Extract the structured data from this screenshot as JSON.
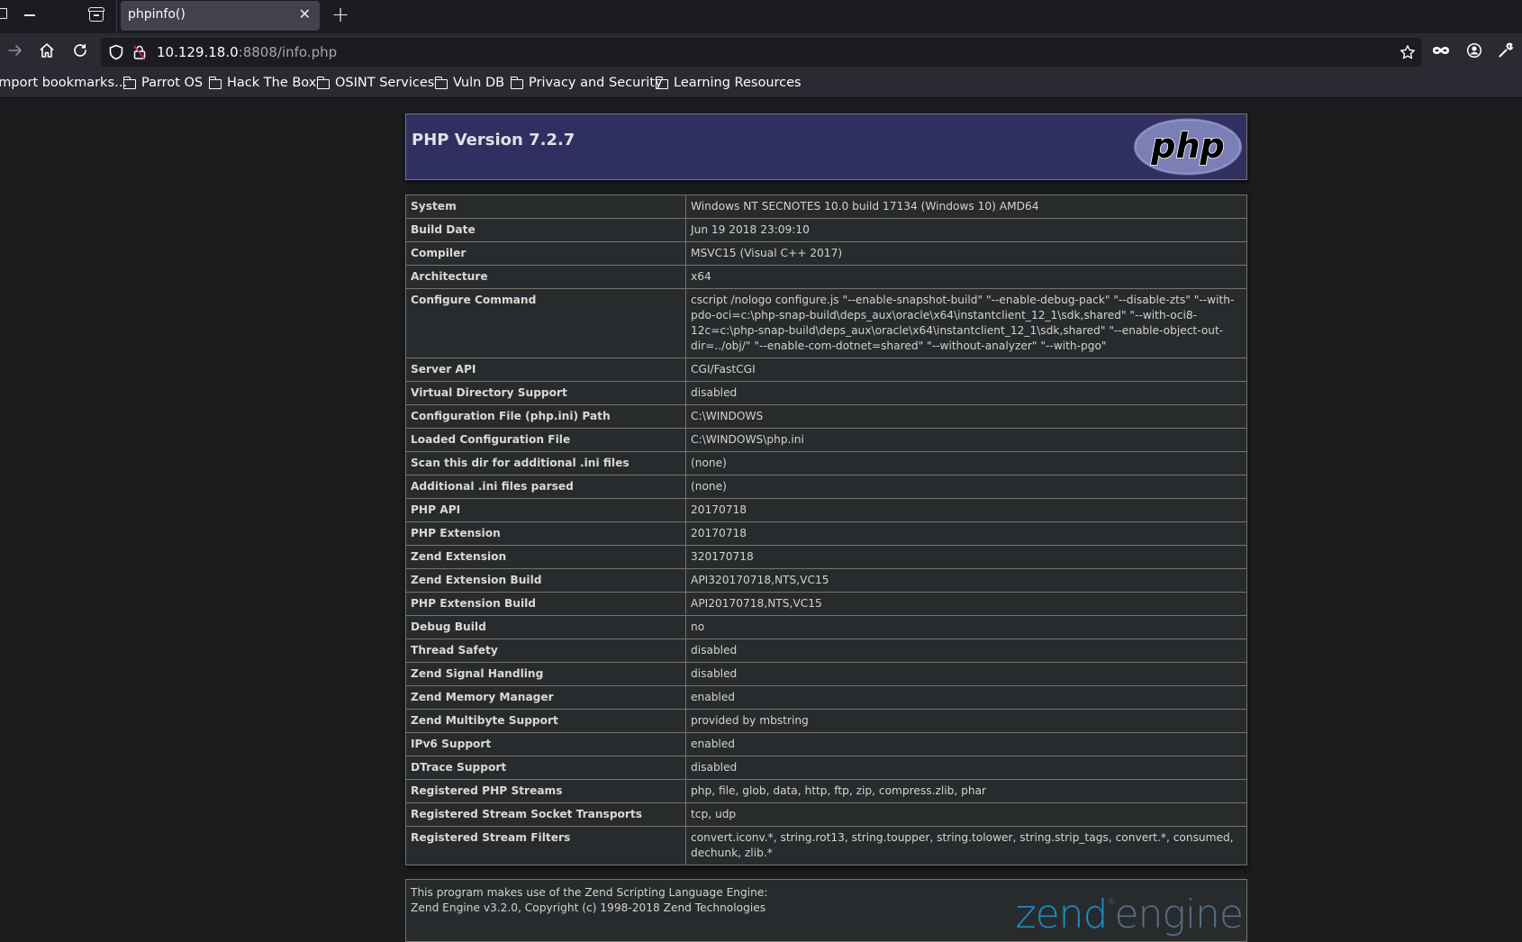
{
  "browser": {
    "tab": {
      "title": "phpinfo()"
    },
    "url": {
      "host": "10.129.18.0",
      "rest": ":8808/info.php"
    },
    "bookmarks": [
      {
        "label": "Import bookmarks…",
        "folder": false
      },
      {
        "label": "Parrot OS",
        "folder": true
      },
      {
        "label": "Hack The Box",
        "folder": true
      },
      {
        "label": "OSINT Services",
        "folder": true
      },
      {
        "label": "Vuln DB",
        "folder": true
      },
      {
        "label": "Privacy and Security",
        "folder": true
      },
      {
        "label": "Learning Resources",
        "folder": true
      }
    ],
    "icons": {
      "back": "arrow-right-icon",
      "home": "home-icon",
      "reload": "reload-icon",
      "tracking": "shield-icon",
      "insecure": "lock-insecure-icon",
      "bookmark": "star-icon",
      "private": "mask-icon",
      "account": "account-icon",
      "tools": "wrench-icon"
    }
  },
  "phpinfo": {
    "title": "PHP Version 7.2.7",
    "logo_text": "php",
    "rows": [
      {
        "key": "System",
        "value": "Windows NT SECNOTES 10.0 build 17134 (Windows 10) AMD64"
      },
      {
        "key": "Build Date",
        "value": "Jun 19 2018 23:09:10"
      },
      {
        "key": "Compiler",
        "value": "MSVC15 (Visual C++ 2017)"
      },
      {
        "key": "Architecture",
        "value": "x64"
      },
      {
        "key": "Configure Command",
        "value": "cscript /nologo configure.js \"--enable-snapshot-build\" \"--enable-debug-pack\" \"--disable-zts\" \"--with-pdo-oci=c:\\php-snap-build\\deps_aux\\oracle\\x64\\instantclient_12_1\\sdk,shared\" \"--with-oci8-12c=c:\\php-snap-build\\deps_aux\\oracle\\x64\\instantclient_12_1\\sdk,shared\" \"--enable-object-out-dir=../obj/\" \"--enable-com-dotnet=shared\" \"--without-analyzer\" \"--with-pgo\""
      },
      {
        "key": "Server API",
        "value": "CGI/FastCGI"
      },
      {
        "key": "Virtual Directory Support",
        "value": "disabled"
      },
      {
        "key": "Configuration File (php.ini) Path",
        "value": "C:\\WINDOWS"
      },
      {
        "key": "Loaded Configuration File",
        "value": "C:\\WINDOWS\\php.ini"
      },
      {
        "key": "Scan this dir for additional .ini files",
        "value": "(none)"
      },
      {
        "key": "Additional .ini files parsed",
        "value": "(none)"
      },
      {
        "key": "PHP API",
        "value": "20170718"
      },
      {
        "key": "PHP Extension",
        "value": "20170718"
      },
      {
        "key": "Zend Extension",
        "value": "320170718"
      },
      {
        "key": "Zend Extension Build",
        "value": "API320170718,NTS,VC15"
      },
      {
        "key": "PHP Extension Build",
        "value": "API20170718,NTS,VC15"
      },
      {
        "key": "Debug Build",
        "value": "no"
      },
      {
        "key": "Thread Safety",
        "value": "disabled"
      },
      {
        "key": "Zend Signal Handling",
        "value": "disabled"
      },
      {
        "key": "Zend Memory Manager",
        "value": "enabled"
      },
      {
        "key": "Zend Multibyte Support",
        "value": "provided by mbstring"
      },
      {
        "key": "IPv6 Support",
        "value": "enabled"
      },
      {
        "key": "DTrace Support",
        "value": "disabled"
      },
      {
        "key": "Registered PHP Streams",
        "value": "php, file, glob, data, http, ftp, zip, compress.zlib, phar"
      },
      {
        "key": "Registered Stream Socket Transports",
        "value": "tcp, udp"
      },
      {
        "key": "Registered Stream Filters",
        "value": "convert.iconv.*, string.rot13, string.toupper, string.tolower, string.strip_tags, convert.*, consumed, dechunk, zlib.*"
      }
    ],
    "zend": {
      "line1": "This program makes use of the Zend Scripting Language Engine:",
      "line2": "Zend Engine v3.2.0, Copyright (c) 1998-2018 Zend Technologies",
      "logo_zend": "zend",
      "logo_engine": "engine"
    }
  }
}
